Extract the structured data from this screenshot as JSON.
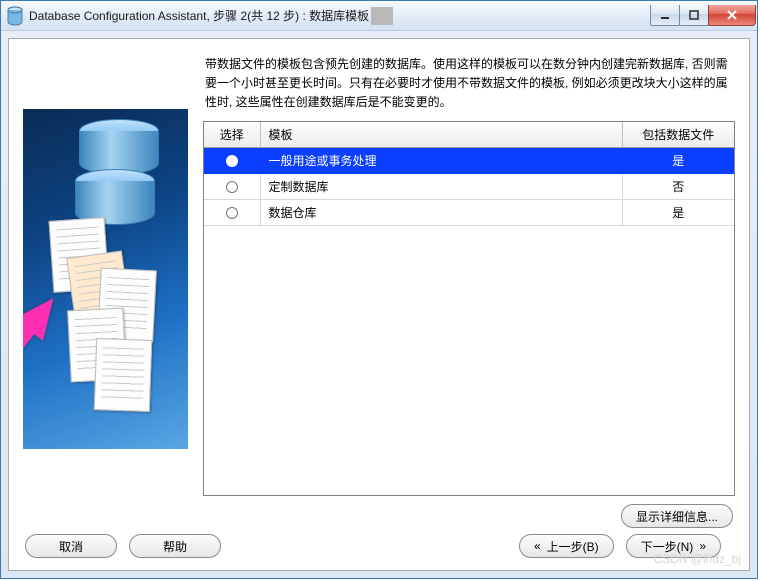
{
  "window": {
    "title": "Database Configuration Assistant, 步骤 2(共 12 步) : 数据库模板"
  },
  "description": "带数据文件的模板包含预先创建的数据库。使用这样的模板可以在数分钟内创建完新数据库, 否则需要一个小时甚至更长时间。只有在必要时才使用不带数据文件的模板, 例如必须更改块大小这样的属性时, 这些属性在创建数据库后是不能变更的。",
  "table": {
    "headers": {
      "select": "选择",
      "template": "模板",
      "includes": "包括数据文件"
    },
    "rows": [
      {
        "template": "一般用途或事务处理",
        "includes": "是",
        "selected": true
      },
      {
        "template": "定制数据库",
        "includes": "否",
        "selected": false
      },
      {
        "template": "数据仓库",
        "includes": "是",
        "selected": false
      }
    ]
  },
  "buttons": {
    "show_details": "显示详细信息...",
    "cancel": "取消",
    "help": "帮助",
    "back": "上一步(B)",
    "next": "下一步(N)"
  },
  "watermark": "CSDN @lhdz_bj"
}
